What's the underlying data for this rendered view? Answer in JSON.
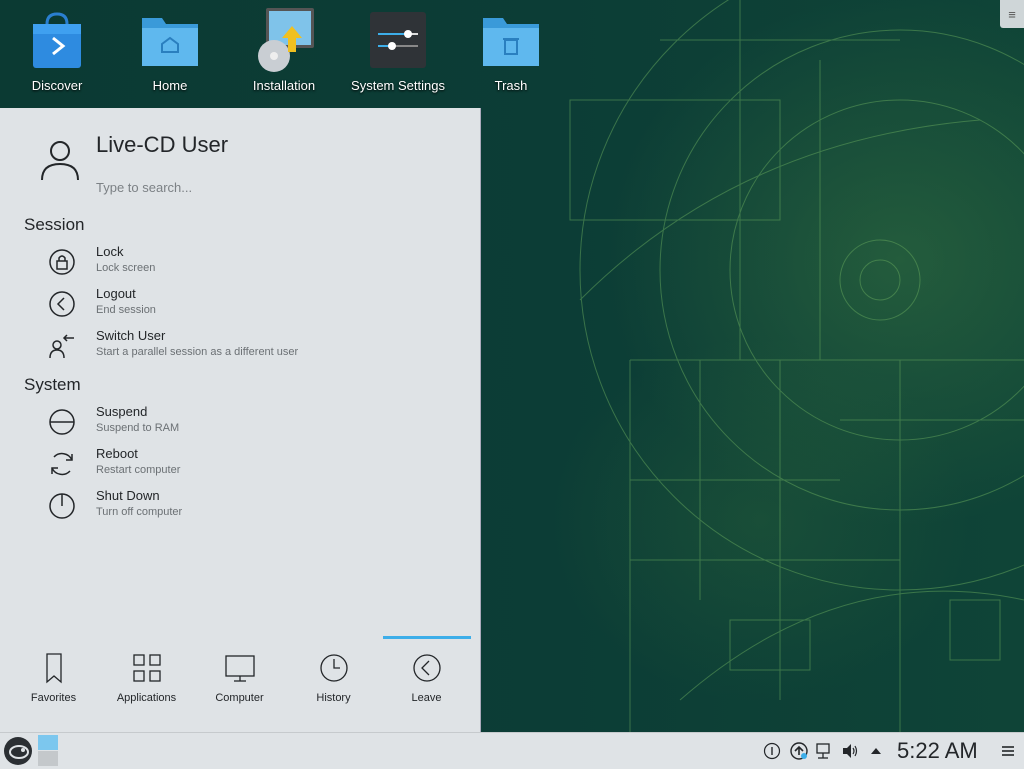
{
  "desktop": {
    "icons": [
      {
        "label": "Discover",
        "icon": "discover-bag-icon"
      },
      {
        "label": "Home",
        "icon": "home-folder-icon"
      },
      {
        "label": "Installation",
        "icon": "installation-disc-icon"
      },
      {
        "label": "System Settings",
        "icon": "settings-sliders-icon"
      },
      {
        "label": "Trash",
        "icon": "trash-folder-icon"
      }
    ],
    "corner_menu_icon": "hamburger-icon"
  },
  "launcher": {
    "user_name": "Live-CD User",
    "search_placeholder": "Type to search...",
    "sections": [
      {
        "title": "Session",
        "items": [
          {
            "title": "Lock",
            "subtitle": "Lock screen",
            "icon": "lock-icon"
          },
          {
            "title": "Logout",
            "subtitle": "End session",
            "icon": "logout-icon"
          },
          {
            "title": "Switch User",
            "subtitle": "Start a parallel session as a different user",
            "icon": "switch-user-icon"
          }
        ]
      },
      {
        "title": "System",
        "items": [
          {
            "title": "Suspend",
            "subtitle": "Suspend to RAM",
            "icon": "suspend-icon"
          },
          {
            "title": "Reboot",
            "subtitle": "Restart computer",
            "icon": "reboot-icon"
          },
          {
            "title": "Shut Down",
            "subtitle": "Turn off computer",
            "icon": "power-icon"
          }
        ]
      }
    ],
    "tabs": [
      {
        "label": "Favorites",
        "icon": "bookmark-icon",
        "active": false
      },
      {
        "label": "Applications",
        "icon": "grid-icon",
        "active": false
      },
      {
        "label": "Computer",
        "icon": "monitor-icon",
        "active": false
      },
      {
        "label": "History",
        "icon": "clock-icon",
        "active": false
      },
      {
        "label": "Leave",
        "icon": "leave-icon",
        "active": true
      }
    ]
  },
  "panel": {
    "clock": "5:22 AM",
    "tray": [
      "clipboard-icon",
      "updates-icon",
      "network-icon",
      "volume-icon",
      "expand-tray-icon"
    ],
    "accent": "#3daee9"
  }
}
